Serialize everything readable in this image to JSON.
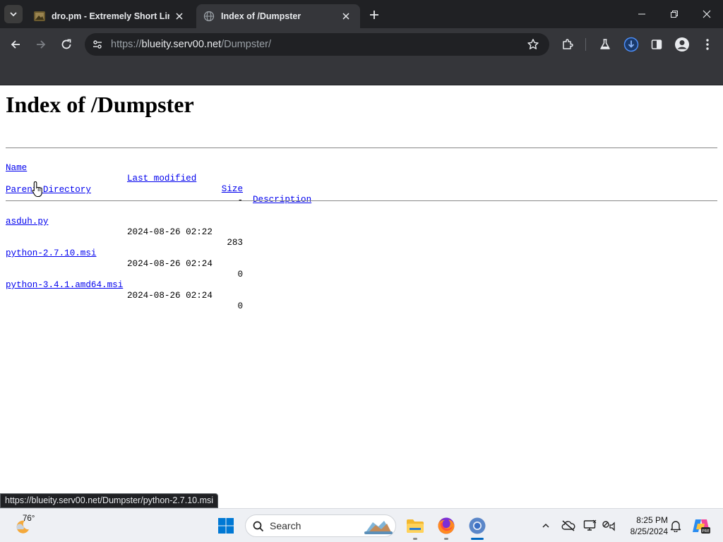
{
  "browser": {
    "tabs": [
      {
        "title": "dro.pm - Extremely Short Links",
        "active": false,
        "favicon": "image-thumbnail-icon"
      },
      {
        "title": "Index of /Dumpster",
        "active": true,
        "favicon": "globe-icon"
      }
    ],
    "url_scheme": "https://",
    "url_host": "blueity.serv00.net",
    "url_path": "/Dumpster/",
    "status_url": "https://blueity.serv00.net/Dumpster/python-2.7.10.msi"
  },
  "page": {
    "title": "Index of /Dumpster",
    "columns": {
      "name": "Name",
      "last_modified": "Last modified",
      "size": "Size",
      "description": "Description"
    },
    "parent_label": "Parent Directory",
    "parent_size": "-",
    "files": [
      {
        "name": "asduh.py",
        "modified": "2024-08-26 02:22",
        "size": "283",
        "visited": false
      },
      {
        "name": "python-2.7.10.msi",
        "modified": "2024-08-26 02:24",
        "size": "0",
        "visited": false
      },
      {
        "name": "python-3.4.1.amd64.msi",
        "modified": "2024-08-26 02:24",
        "size": "0",
        "visited": false
      }
    ]
  },
  "taskbar": {
    "weather_temp": "76°",
    "search_label": "Search",
    "time": "8:25 PM",
    "date": "8/25/2024"
  },
  "colors": {
    "link": "#0000ee",
    "chrome_dark": "#202124",
    "chrome_toolbar": "#35363a",
    "accent": "#0067c0"
  }
}
